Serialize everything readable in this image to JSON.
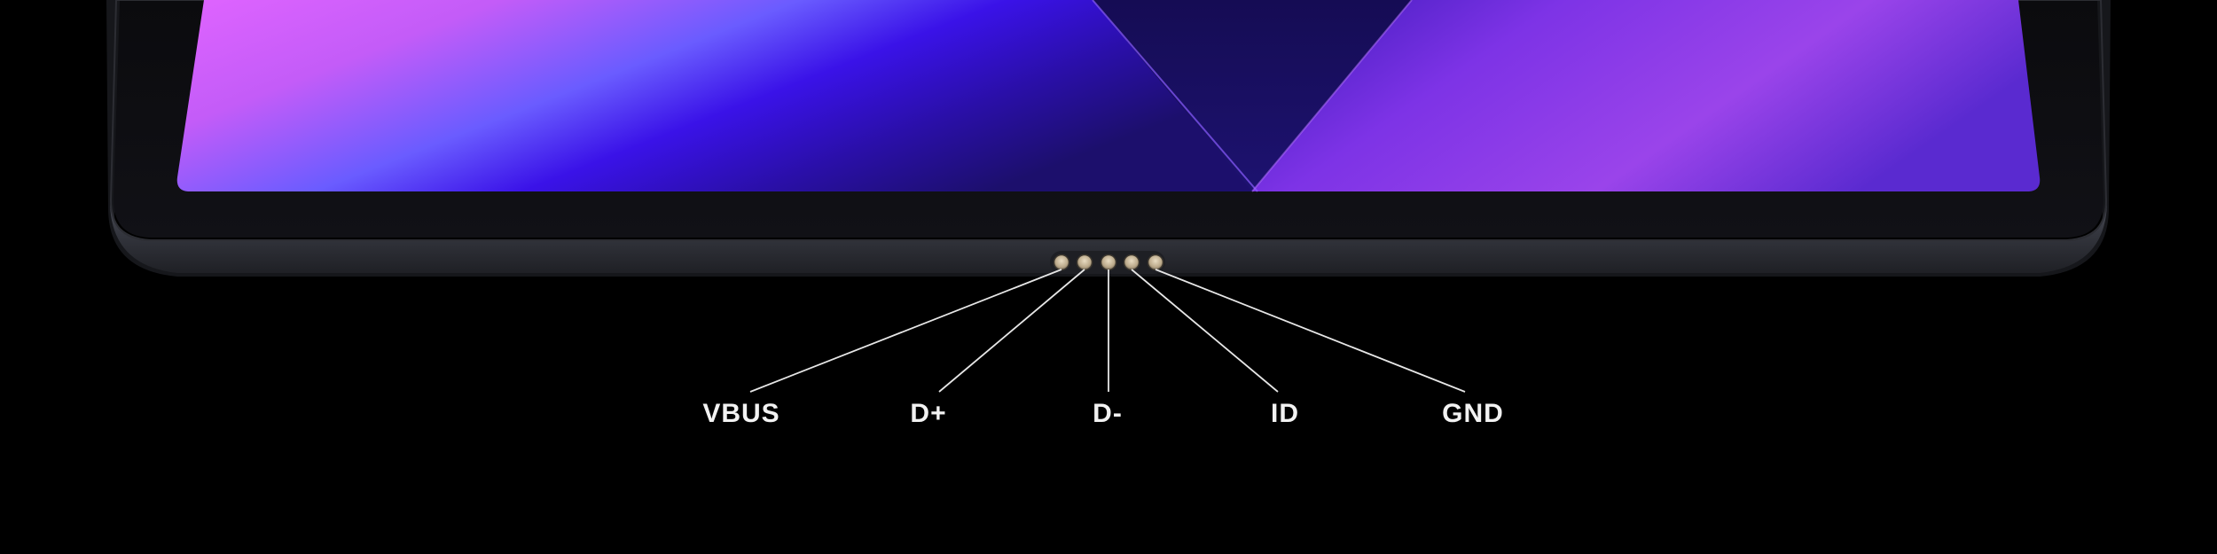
{
  "pins": [
    {
      "id": "vbus",
      "label": "VBUS"
    },
    {
      "id": "dplus",
      "label": "D+"
    },
    {
      "id": "dminus",
      "label": "D-"
    },
    {
      "id": "id",
      "label": "ID"
    },
    {
      "id": "gnd",
      "label": "GND"
    }
  ]
}
